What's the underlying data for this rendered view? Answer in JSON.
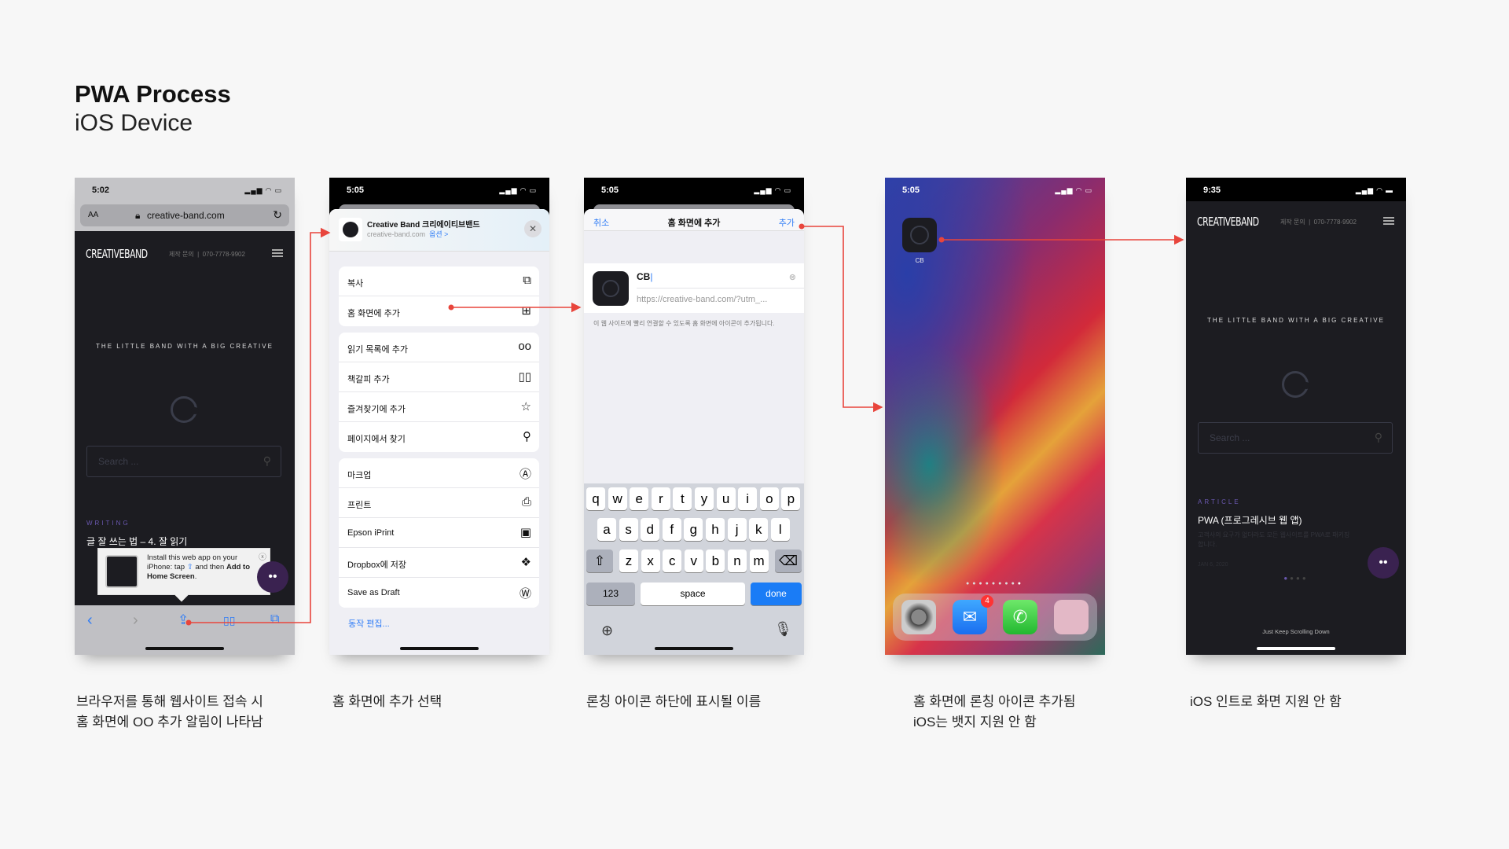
{
  "header": {
    "title": "PWA Process",
    "subtitle": "iOS Device"
  },
  "colors": {
    "arrow": "#e8453c",
    "ios_blue": "#2f7cf6",
    "site_bg": "#1c1c21",
    "accent_purple": "#6a58b0"
  },
  "site": {
    "logo": "CREATIVEBAND",
    "inquiry": "제작 문의",
    "phone": "070-7778-9902",
    "tagline": "THE LITTLE BAND WITH A BIG CREATIVE",
    "search_placeholder": "Search ..."
  },
  "phone1": {
    "time": "5:02",
    "aa": "AA",
    "url": "creative-band.com",
    "category": "WRITING",
    "post_title": "글 잘 쓰는 법 – 4. 잘 읽기",
    "popup": {
      "text1": "Install this web app on your iPhone: tap",
      "text2": "and then",
      "bold": "Add to Home Screen",
      "end": "."
    }
  },
  "phone2": {
    "time": "5:05",
    "site_title": "Creative Band 크리에이티브밴드",
    "site_url": "creative-band.com",
    "options": "옵션 >",
    "groups": [
      [
        {
          "label": "복사",
          "icon": "copy-icon",
          "glyph": "⧉"
        },
        {
          "label": "홈 화면에 추가",
          "icon": "add-square-icon",
          "glyph": "⊞"
        }
      ],
      [
        {
          "label": "읽기 목록에 추가",
          "icon": "glasses-icon",
          "glyph": "oo"
        },
        {
          "label": "책갈피 추가",
          "icon": "book-icon",
          "glyph": "▯▯"
        },
        {
          "label": "즐겨찾기에 추가",
          "icon": "star-icon",
          "glyph": "☆"
        },
        {
          "label": "페이지에서 찾기",
          "icon": "search-icon",
          "glyph": "⚲"
        }
      ],
      [
        {
          "label": "마크업",
          "icon": "markup-icon",
          "glyph": "Ⓐ"
        },
        {
          "label": "프린트",
          "icon": "print-icon",
          "glyph": "⎙"
        },
        {
          "label": "Epson iPrint",
          "icon": "epson-icon",
          "glyph": "▣"
        },
        {
          "label": "Dropbox에 저장",
          "icon": "dropbox-icon",
          "glyph": "❖"
        },
        {
          "label": "Save as Draft",
          "icon": "wordpress-icon",
          "glyph": "Ⓦ"
        }
      ]
    ],
    "edit_actions": "동작 편집..."
  },
  "phone3": {
    "time": "5:05",
    "cancel": "취소",
    "nav_title": "홈 화면에 추가",
    "add": "추가",
    "name_value": "CB",
    "url": "https://creative-band.com/?utm_...",
    "help": "이 웹 사이트에 빨리 연결할 수 있도록 홈 화면에 아이콘이 추가됩니다.",
    "keyboard": {
      "row1": [
        "q",
        "w",
        "e",
        "r",
        "t",
        "y",
        "u",
        "i",
        "o",
        "p"
      ],
      "row2": [
        "a",
        "s",
        "d",
        "f",
        "g",
        "h",
        "j",
        "k",
        "l"
      ],
      "row3": [
        "z",
        "x",
        "c",
        "v",
        "b",
        "n",
        "m"
      ],
      "shift": "⇧",
      "delete": "⌫",
      "num": "123",
      "space": "space",
      "done": "done"
    }
  },
  "phone4": {
    "time": "5:05",
    "app_label": "CB",
    "mail_badge": "4",
    "page_count": 9,
    "current_page": 9,
    "dock": [
      "settings-icon",
      "mail-icon",
      "phone-icon",
      "folder-icon"
    ]
  },
  "phone5": {
    "time": "9:35",
    "category": "ARTICLE",
    "post_title": "PWA (프로그레시브 웹 앱)",
    "excerpt": "고객사의 요구가 없더라도 모든 웹사이트를 PWA로 패키징합니다.",
    "date": "JAN 6, 2020",
    "scroll_hint": "Just Keep Scrolling Down"
  },
  "captions": [
    {
      "line1": "브라우저를 통해 웹사이트 접속 시",
      "line2": "홈 화면에 OO 추가 알림이 나타남"
    },
    {
      "line1": "홈 화면에 추가 선택",
      "line2": ""
    },
    {
      "line1": "론칭 아이콘 하단에 표시될 이름",
      "line2": ""
    },
    {
      "line1": "홈 화면에 론칭 아이콘 추가됨",
      "line2": "iOS는 뱃지 지원 안 함"
    },
    {
      "line1": "iOS 인트로 화면 지원 안 함",
      "line2": ""
    }
  ]
}
